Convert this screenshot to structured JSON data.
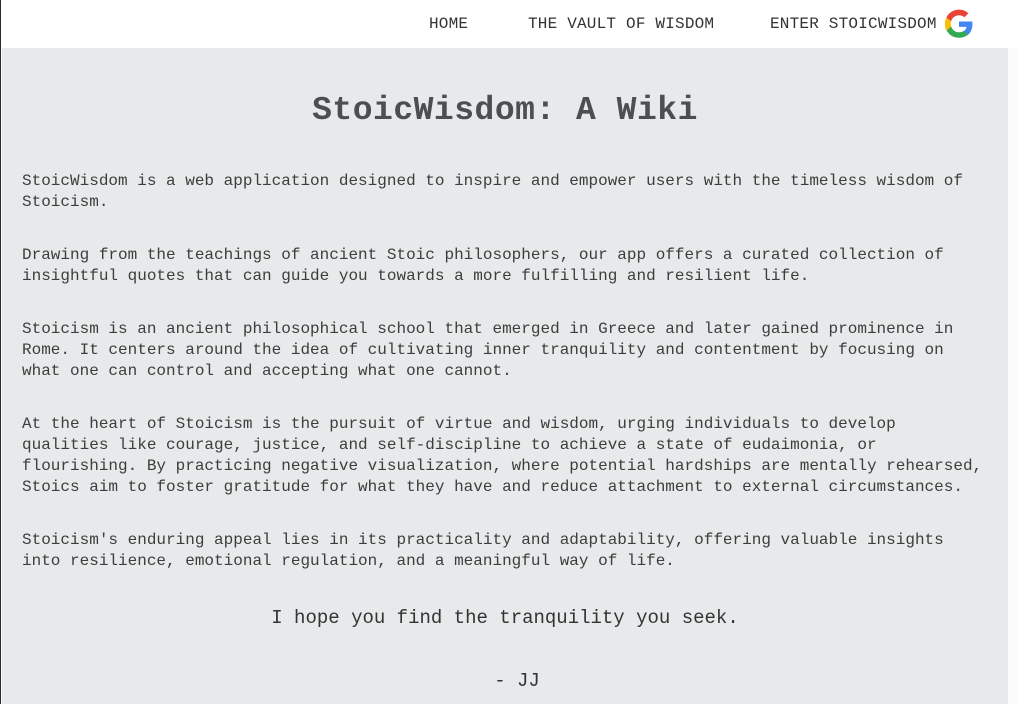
{
  "nav": {
    "home": "HOME",
    "vault": "THE VAULT OF WISDOM",
    "enter": "ENTER STOICWISDOM",
    "signin_icon": "google-icon",
    "google_colors": {
      "blue": "#4285F4",
      "red": "#EA4335",
      "yellow": "#FBBC05",
      "green": "#34A853"
    }
  },
  "main": {
    "title": "StoicWisdom: A Wiki",
    "paragraphs": [
      "StoicWisdom is a web application designed to inspire and empower users with the timeless wisdom of\nStoicism.",
      "Drawing from the teachings of ancient Stoic philosophers, our app offers a curated collection of\ninsightful quotes that can guide you towards a more fulfilling and resilient life.",
      "Stoicism is an ancient philosophical school that emerged in Greece and later gained prominence in\nRome. It centers around the idea of cultivating inner tranquility and contentment by focusing on\nwhat one can control and accepting what one cannot.",
      "At the heart of Stoicism is the pursuit of virtue and wisdom, urging individuals to develop\nqualities like courage, justice, and self-discipline to achieve a state of eudaimonia, or\nflourishing. By practicing negative visualization, where potential hardships are mentally rehearsed,\nStoics aim to foster gratitude for what they have and reduce attachment to external circumstances.",
      "Stoicism's enduring appeal lies in its practicality and adaptability, offering valuable insights\ninto resilience, emotional regulation, and a meaningful way of life."
    ],
    "closing": "I hope you find the tranquility you seek.",
    "signature": "- JJ"
  },
  "colors": {
    "content_background": "#e7eaea",
    "title_text": "#4b4f4f",
    "body_text": "#3d3d3d"
  }
}
